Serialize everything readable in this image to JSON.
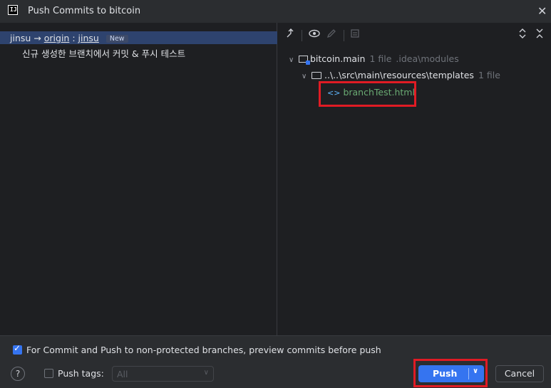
{
  "window": {
    "title": "Push Commits to bitcoin",
    "app_icon": "intellij-icon",
    "close_icon": "close-icon"
  },
  "commits": [
    {
      "local_branch": "jinsu",
      "arrow": "→",
      "remote": "origin",
      "separator": ":",
      "remote_branch": "jinsu",
      "badge": "New",
      "message": "신규 생성한 브랜치에서 커밋 & 푸시 테스트"
    }
  ],
  "toolbar": {
    "icons": [
      "merge-arrow-icon",
      "eye-icon",
      "edit-icon",
      "diff-icon",
      "expand-icon",
      "collapse-icon"
    ]
  },
  "tree": {
    "module": {
      "name": "bitcoin.main",
      "count": "1 file",
      "path": ".idea\\modules"
    },
    "folder": {
      "name": "..\\..\\src\\main\\resources\\templates",
      "count": "1 file"
    },
    "file": {
      "name": "branchTest.html",
      "icon": "<>"
    }
  },
  "bottom": {
    "preview_checkbox": {
      "checked": true,
      "label": "For Commit and Push to non-protected branches, preview commits before push"
    },
    "help": "?",
    "push_tags": {
      "checked": false,
      "label": "Push tags:",
      "value": "All"
    },
    "push_button": "Push",
    "cancel_button": "Cancel"
  },
  "colors": {
    "accent": "#3574f0",
    "selection": "#2e436e",
    "highlight": "#e01b24",
    "file_green": "#6aab73"
  }
}
